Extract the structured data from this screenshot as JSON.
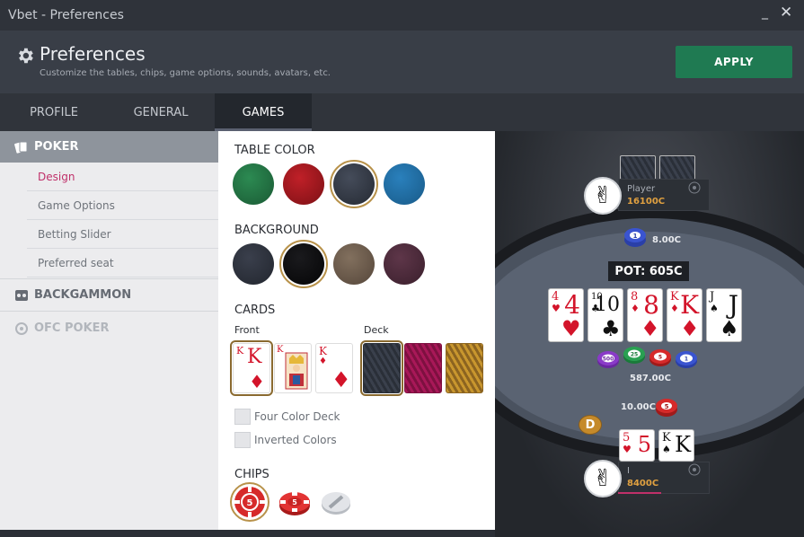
{
  "window": {
    "title": "Vbet - Preferences",
    "minimize": "_",
    "close": "✕"
  },
  "header": {
    "title": "Preferences",
    "subtitle": "Customize the tables, chips, game options, sounds,  avatars, etc.",
    "apply_label": "APPLY"
  },
  "tabs": [
    {
      "label": "PROFILE"
    },
    {
      "label": "GENERAL"
    },
    {
      "label": "GAMES",
      "active": true
    }
  ],
  "sidebar": {
    "poker": "POKER",
    "items": [
      {
        "label": "Design",
        "active": true
      },
      {
        "label": "Game Options"
      },
      {
        "label": "Betting Slider"
      },
      {
        "label": "Preferred seat"
      }
    ],
    "backgammon": "BACKGAMMON",
    "ofc": "OFC POKER"
  },
  "design": {
    "table_color_title": "TABLE COLOR",
    "table_colors": [
      "#1f6a3e",
      "#a3161c",
      "#343a47",
      "#1e6aa0"
    ],
    "background_title": "BACKGROUND",
    "backgrounds": [
      "#2c303b",
      "#0d0d0f",
      "#6e5a48",
      "#4c2a3b"
    ],
    "cards_title": "CARDS",
    "front_label": "Front",
    "deck_label": "Deck",
    "four_color": "Four Color Deck",
    "inverted": "Inverted Colors",
    "chips_title": "CHIPS",
    "chip_value": "5",
    "card_front_rank": "K"
  },
  "table": {
    "opponent": {
      "name": "Player",
      "stack": "16100C",
      "bet": "8.00C"
    },
    "pot_label": "POT:",
    "pot_value": "605C",
    "board": [
      {
        "rank": "4",
        "suit": "♥",
        "color": "red"
      },
      {
        "rank": "10",
        "suit": "♣",
        "color": "blk"
      },
      {
        "rank": "8",
        "suit": "♦",
        "color": "red"
      },
      {
        "rank": "K",
        "suit": "♦",
        "color": "red"
      },
      {
        "rank": "J",
        "suit": "♠",
        "color": "blk"
      }
    ],
    "chip_labels": [
      "500",
      "25",
      "5",
      "1"
    ],
    "center_amount": "587.00C",
    "hero": {
      "name": "I",
      "stack": "8400C",
      "bet": "10.00C"
    },
    "hero_cards": [
      {
        "rank": "5",
        "suit": "♥",
        "color": "red"
      },
      {
        "rank": "K",
        "suit": "♠",
        "color": "blk"
      }
    ],
    "dealer": "D",
    "opp_chip": "1",
    "hero_chip": "5"
  }
}
